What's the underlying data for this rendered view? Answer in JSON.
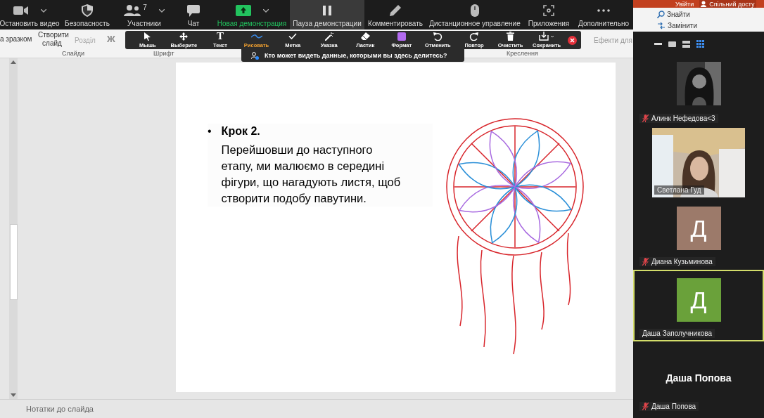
{
  "zoom_toolbar": {
    "buttons": [
      {
        "label": "Остановить видео",
        "kind": "video",
        "dropdown": true,
        "selected": false
      },
      {
        "label": "Безопасность",
        "kind": "security",
        "dropdown": false,
        "selected": false
      },
      {
        "label": "Участники",
        "kind": "participants",
        "count": "7",
        "dropdown": true,
        "selected": false
      },
      {
        "label": "Чат",
        "kind": "chat",
        "dropdown": false,
        "selected": false
      },
      {
        "label": "Новая демонстрация",
        "kind": "share",
        "dropdown": true,
        "selected": false
      },
      {
        "label": "Пауза демонстрации",
        "kind": "pause",
        "dropdown": false,
        "selected": true
      },
      {
        "label": "Комментировать",
        "kind": "annotate",
        "dropdown": false,
        "selected": false
      },
      {
        "label": "Дистанционное управление",
        "kind": "remote",
        "dropdown": false,
        "selected": false
      },
      {
        "label": "Приложения",
        "kind": "apps",
        "dropdown": false,
        "selected": false
      },
      {
        "label": "Дополнительно",
        "kind": "more",
        "dropdown": false,
        "selected": false
      }
    ]
  },
  "annotation_toolbar": {
    "tools": [
      {
        "label": "Мышь",
        "kind": "mouse",
        "selected": false
      },
      {
        "label": "Выберите",
        "kind": "select",
        "selected": false
      },
      {
        "label": "Текст",
        "kind": "text",
        "glyph": "T",
        "selected": false
      },
      {
        "label": "Рисовать",
        "kind": "draw",
        "selected": true
      },
      {
        "label": "Метка",
        "kind": "stamp",
        "selected": false
      },
      {
        "label": "Указка",
        "kind": "spotlight",
        "selected": false
      },
      {
        "label": "Ластик",
        "kind": "eraser",
        "selected": false
      },
      {
        "label": "Формат",
        "kind": "format",
        "color": "#b36bf0",
        "selected": false
      },
      {
        "label": "Отменить",
        "kind": "undo",
        "selected": false
      },
      {
        "label": "Повтор",
        "kind": "redo",
        "selected": false
      },
      {
        "label": "Очистить",
        "kind": "clear",
        "selected": false
      },
      {
        "label": "Сохранить",
        "kind": "save",
        "selected": false
      }
    ]
  },
  "share_tooltip": "Кто может видеть данные, которыми вы здесь делитесь?",
  "ribbon": {
    "layout": "а зразком",
    "new_slide": "Створити слайд",
    "section": {
      "label": "Розділ",
      "disabled": true
    },
    "bold": "Ж",
    "effects": "Ефекти для",
    "groups": [
      "Слайди",
      "Шрифт",
      "Креслення"
    ],
    "sign_in": "Увійти",
    "share": "Спільний досту",
    "find": "Знайти",
    "replace": "Замінити"
  },
  "slide": {
    "marker": "•",
    "heading": "Крок 2.",
    "text": "Перейшовши до наступного етапу, ми малюємо в середині фігури, що нагадують листя, щоб створити подобу павутини."
  },
  "notes": "Нотатки до слайда",
  "gallery": {
    "participants": [
      {
        "name": "Алинк Нефедова<3",
        "muted": true,
        "selected": false
      },
      {
        "kind": "video",
        "name": "Светлана Гуд",
        "muted": false,
        "selected": false
      },
      {
        "kind": "initial",
        "initial": "Д",
        "color": "#9c7a6a",
        "name": "Диана Кузьминова",
        "muted": true,
        "selected": false
      },
      {
        "kind": "initial",
        "initial": "Д",
        "color": "#6aa13a",
        "name": "Даша Заполучникова",
        "muted": false,
        "selected": true
      },
      {
        "kind": "name",
        "title": "Даша Попова",
        "name": "Даша Попова",
        "muted": true,
        "selected": false
      }
    ]
  }
}
